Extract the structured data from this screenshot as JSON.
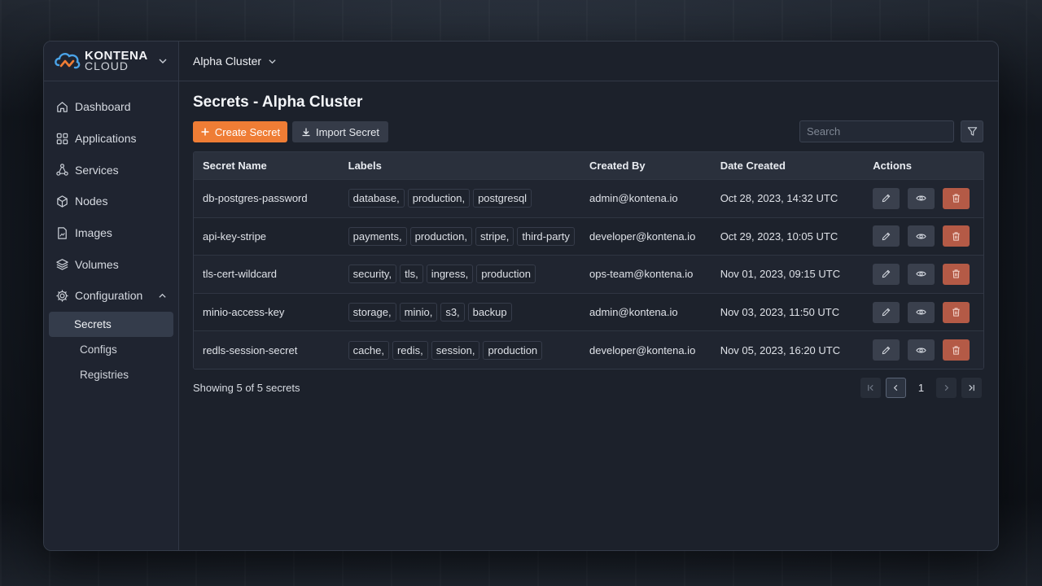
{
  "brand": {
    "name": "KONTENA",
    "sub": "CLOUD"
  },
  "sidebar": {
    "items": [
      {
        "label": "Dashboard",
        "icon": "home-icon"
      },
      {
        "label": "Applications",
        "icon": "grid-icon"
      },
      {
        "label": "Services",
        "icon": "network-icon"
      },
      {
        "label": "Nodes",
        "icon": "cube-icon"
      },
      {
        "label": "Images",
        "icon": "image-icon"
      },
      {
        "label": "Volumes",
        "icon": "layers-icon"
      },
      {
        "label": "Configuration",
        "icon": "gear-icon"
      }
    ],
    "sub_items": [
      {
        "label": "Secrets"
      },
      {
        "label": "Configs"
      },
      {
        "label": "Registries"
      }
    ]
  },
  "header": {
    "cluster": "Alpha Cluster"
  },
  "page": {
    "title": "Secrets - Alpha Cluster",
    "create_label": "Create Secret",
    "import_label": "Import Secret",
    "search_placeholder": "Search"
  },
  "table": {
    "headers": [
      "Secret Name",
      "Labels",
      "Created By",
      "Date Created",
      "Actions"
    ],
    "rows": [
      {
        "name": "db-postgres-password",
        "labels": [
          "database,",
          "production,",
          "postgresql"
        ],
        "created_by": "admin@kontena.io",
        "date": "Oct 28, 2023, 14:32 UTC"
      },
      {
        "name": "api-key-stripe",
        "labels": [
          "payments,",
          "production,",
          "stripe,",
          "third-party"
        ],
        "created_by": "developer@kontena.io",
        "date": "Oct 29, 2023, 10:05 UTC"
      },
      {
        "name": "tls-cert-wildcard",
        "labels": [
          "security,",
          "tls,",
          "ingress,",
          "production"
        ],
        "created_by": "ops-team@kontena.io",
        "date": "Nov 01, 2023, 09:15 UTC"
      },
      {
        "name": "minio-access-key",
        "labels": [
          "storage,",
          "minio,",
          "s3,",
          "backup"
        ],
        "created_by": "admin@kontena.io",
        "date": "Nov 03, 2023, 11:50 UTC"
      },
      {
        "name": "redls-session-secret",
        "labels": [
          "cache,",
          "redis,",
          "session,",
          "production"
        ],
        "created_by": "developer@kontena.io",
        "date": "Nov 05, 2023, 16:20 UTC"
      }
    ]
  },
  "footer": {
    "showing": "Showing 5 of 5 secrets",
    "page": "1"
  },
  "colors": {
    "accent": "#ef7d35",
    "delete": "#b45a46"
  }
}
